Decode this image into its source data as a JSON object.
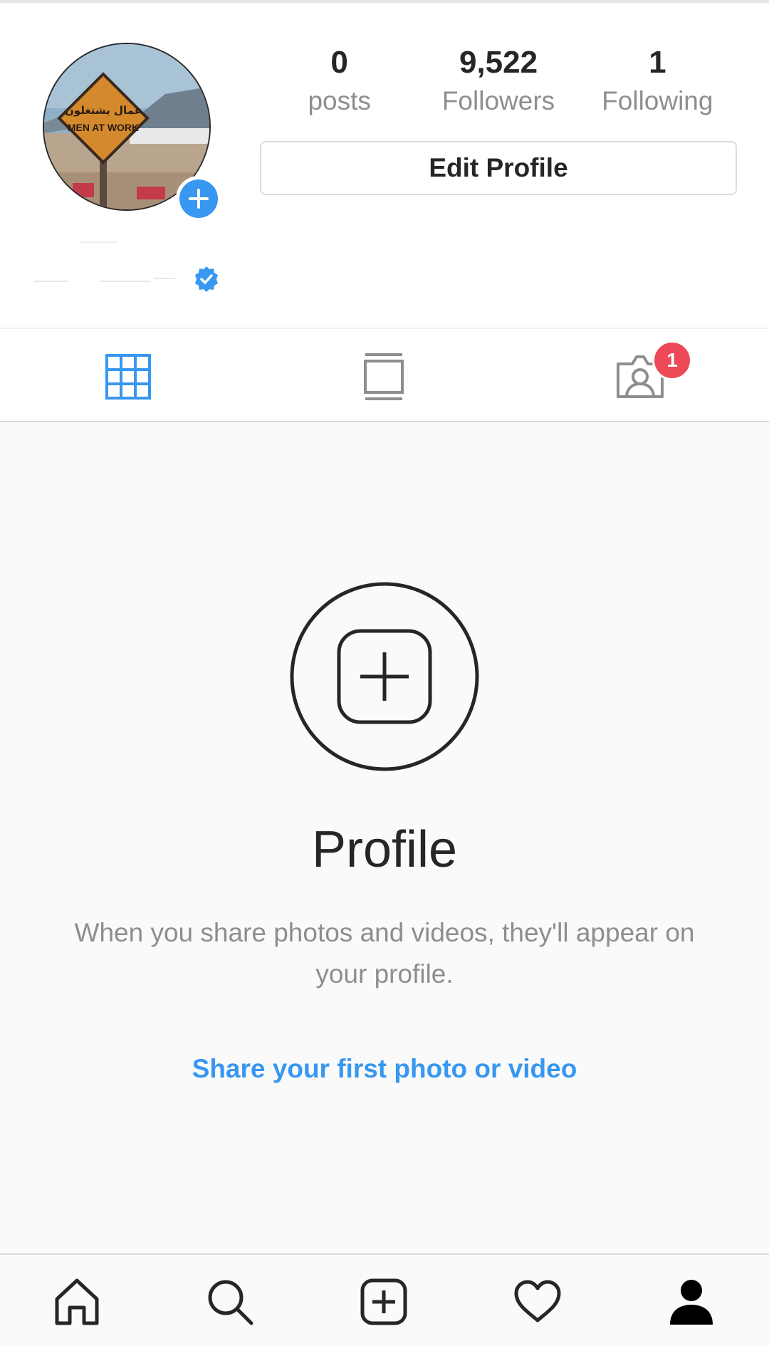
{
  "profile": {
    "stats": [
      {
        "value": "0",
        "label": "posts"
      },
      {
        "value": "9,522",
        "label": "Followers"
      },
      {
        "value": "1",
        "label": "Following"
      }
    ],
    "edit_button_label": "Edit Profile",
    "avatar_sign_text_arabic": "عمال يشتغلون",
    "avatar_sign_text": "MEN AT WORK",
    "verified": true
  },
  "tabs": {
    "items": [
      {
        "icon": "grid-icon",
        "active": true
      },
      {
        "icon": "feed-icon",
        "active": false
      },
      {
        "icon": "tagged-icon",
        "active": false
      }
    ],
    "tagged_badge_count": "1"
  },
  "empty_state": {
    "title": "Profile",
    "description": "When you share photos and videos, they'll appear on your profile.",
    "cta_link": "Share your first photo or video"
  },
  "bottom_nav": {
    "items": [
      "home-icon",
      "search-icon",
      "new-post-icon",
      "activity-heart-icon",
      "profile-icon"
    ],
    "active": "profile-icon"
  },
  "colors": {
    "accent_blue": "#3897f0",
    "badge_red": "#ed4956",
    "text_primary": "#262626",
    "text_secondary": "#8e8e8e"
  }
}
